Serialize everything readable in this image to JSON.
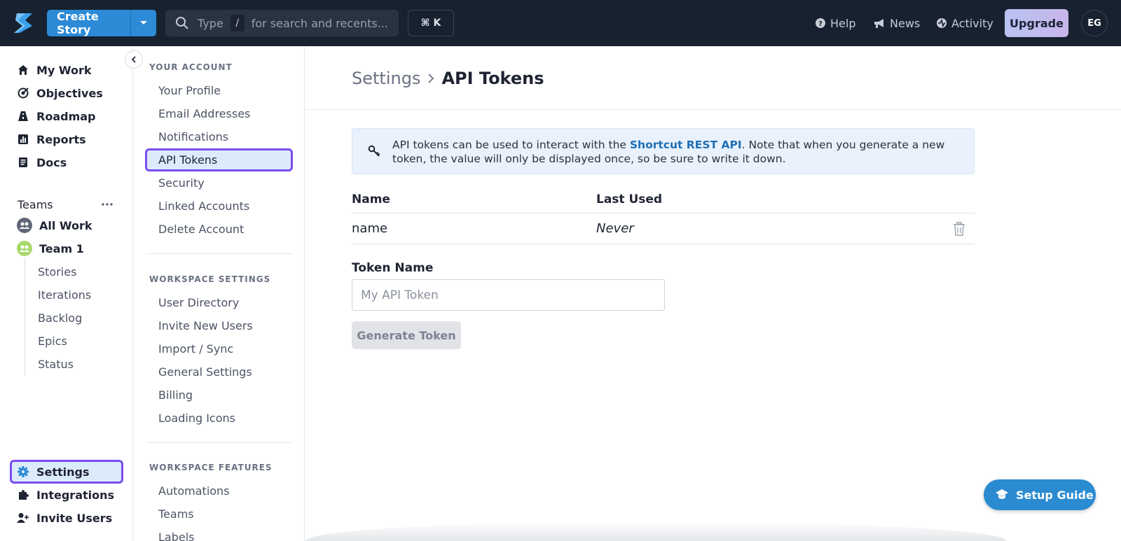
{
  "topbar": {
    "create_story": "Create Story",
    "search_type": "Type",
    "search_slash": "/",
    "search_placeholder": "for search and recents...",
    "shortcut": "⌘ K",
    "help": "Help",
    "news": "News",
    "activity": "Activity",
    "upgrade": "Upgrade",
    "avatar_initials": "EG"
  },
  "sidebar": {
    "main_items": [
      {
        "label": "My Work",
        "icon": "home-icon"
      },
      {
        "label": "Objectives",
        "icon": "target-icon"
      },
      {
        "label": "Roadmap",
        "icon": "roadmap-icon"
      },
      {
        "label": "Reports",
        "icon": "chart-icon"
      },
      {
        "label": "Docs",
        "icon": "doc-icon"
      }
    ],
    "teams_title": "Teams",
    "teams": [
      {
        "label": "All Work",
        "icon": "users-icon"
      },
      {
        "label": "Team 1",
        "icon": "team-icon"
      }
    ],
    "team_sub_items": [
      "Stories",
      "Iterations",
      "Backlog",
      "Epics",
      "Status"
    ],
    "bottom_items": [
      {
        "label": "Settings",
        "icon": "gear-icon"
      },
      {
        "label": "Integrations",
        "icon": "puzzle-icon"
      },
      {
        "label": "Invite Users",
        "icon": "add-user-icon"
      }
    ]
  },
  "settings_nav": {
    "your_account_title": "YOUR ACCOUNT",
    "your_account": [
      "Your Profile",
      "Email Addresses",
      "Notifications",
      "API Tokens",
      "Security",
      "Linked Accounts",
      "Delete Account"
    ],
    "workspace_settings_title": "WORKSPACE SETTINGS",
    "workspace_settings": [
      "User Directory",
      "Invite New Users",
      "Import / Sync",
      "General Settings",
      "Billing",
      "Loading Icons"
    ],
    "workspace_features_title": "WORKSPACE FEATURES",
    "workspace_features": [
      "Automations",
      "Teams",
      "Labels"
    ]
  },
  "main": {
    "breadcrumb_parent": "Settings",
    "breadcrumb_current": "API Tokens",
    "info_before": "API tokens can be used to interact with the ",
    "info_link": "Shortcut REST API",
    "info_after": ". Note that when you generate a new token, the value will only be displayed once, so be sure to write it down.",
    "table_headers": {
      "name": "Name",
      "last_used": "Last Used"
    },
    "table_rows": [
      {
        "name": "name",
        "last_used": "Never"
      }
    ],
    "token_name_label": "Token Name",
    "token_name_placeholder": "My API Token",
    "generate_button": "Generate Token"
  },
  "setup_guide": "Setup Guide",
  "colors": {
    "topbar_bg": "#17212f",
    "accent_blue": "#2c8ad6",
    "highlight_outline": "#7a4df0",
    "highlight_fill": "#dcebfb"
  }
}
